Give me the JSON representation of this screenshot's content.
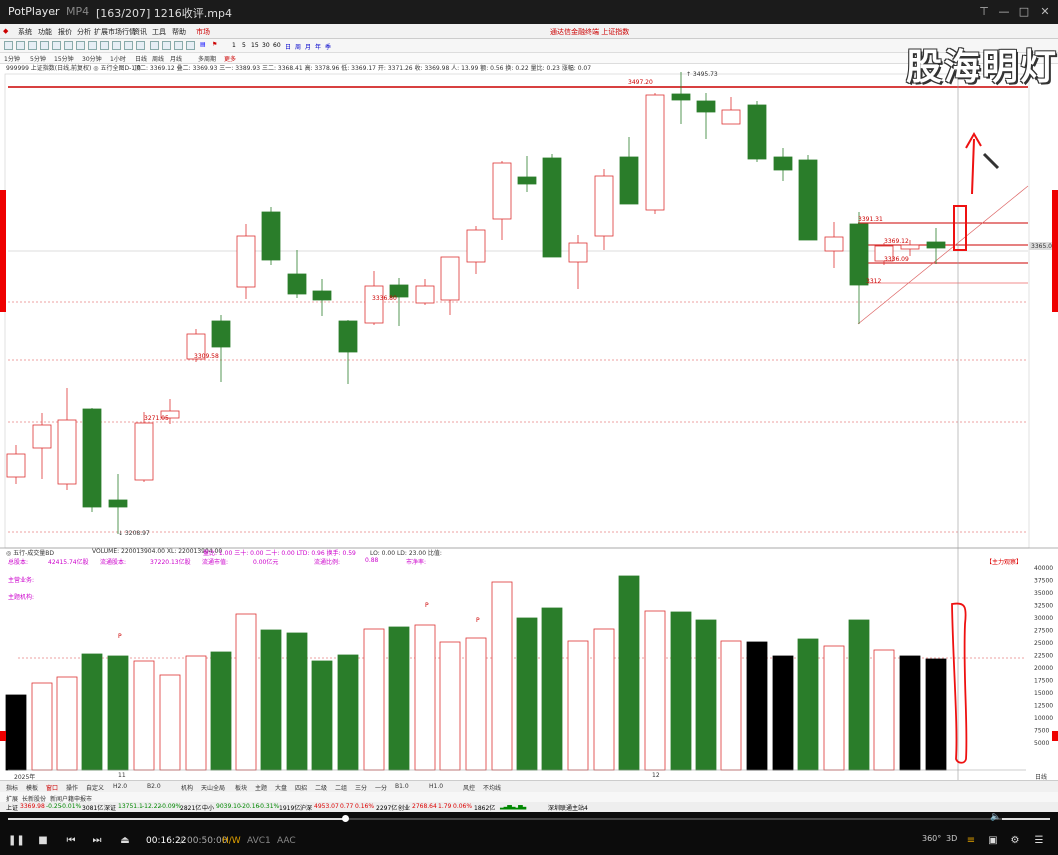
{
  "player": {
    "app_name": "PotPlayer",
    "format": "MP4",
    "file_title": "[163/207] 1216收评.mp4",
    "time_current": "00:16:22",
    "time_total": "00:50:00",
    "hw": "H/W",
    "video_codec": "AVC1",
    "audio_codec": "AAC",
    "progress": 0.327,
    "btn_360": "360°",
    "btn_3d": "3D",
    "watermark": "股海明灯"
  },
  "menu": {
    "items": [
      "系统",
      "功能",
      "报价",
      "分析",
      "扩展市场行情",
      "资讯",
      "工具",
      "帮助"
    ],
    "active": "市场",
    "center_notice": "通达信金融终端 上证指数"
  },
  "periods": [
    "1分钟",
    "5分钟",
    "15分钟",
    "30分钟",
    "1小时",
    "日线",
    "周线",
    "月线",
    "多周期",
    "更多"
  ],
  "toolbar_nums": [
    "1",
    "5",
    "15",
    "30",
    "60",
    "日",
    "周",
    "月",
    "年",
    "季"
  ],
  "chart": {
    "info_line": "999999 上证指数(日线,前复权) ◎ 五行全图D-1.0",
    "info_values": "顶二: 3369.12  叠二: 3369.93  三一: 3389.93  三二: 3368.41  高: 3378.96  低: 3369.17  开: 3371.26  收: 3369.98  人: 13.99  额: 0.56  换: 0.22  量比: 0.23  涨幅: 0.07",
    "price_labels": {
      "hi1": "3497.20",
      "hi2": "3495.73",
      "l3391": "3391.31",
      "l3369": "3369.12",
      "l3336b": "3336.09",
      "l3336": "3336.80",
      "l3309": "3309.58",
      "l3271": "3271.05",
      "lo": "3208.97",
      "right": "3365.0",
      "small": "3312"
    }
  },
  "volume": {
    "title": "◎ 五行-成交量BD",
    "vol_line": "VOLUME: 220013904.00  XL: 220013904.00",
    "ratio_line": "量比: 1.00   三十: 0.00   二十: 0.00   LTD: 0.96   换手: 0.59",
    "lo_line": "LO: 0.00  LD: 23.00  比值:",
    "total_label": "总股本:",
    "total_val": "42415.74亿股",
    "float_label": "流通股本:",
    "float_val": "37220.13亿股",
    "mktcap_label": "流通市值:",
    "mktcap_val": "0.00亿元",
    "ratio_label": "流通比例:",
    "ratio_val": "0.88",
    "pe_label": "市净率:",
    "main_label": "主力流入:",
    "main_label2": "主营业务:",
    "main_label3": "主题机构:",
    "top_right": "【主力观察】",
    "scale": [
      "40000",
      "37500",
      "35000",
      "32500",
      "30000",
      "27500",
      "25000",
      "22500",
      "20000",
      "17500",
      "15000",
      "12500",
      "10000",
      "7500",
      "5000"
    ],
    "year": "2025年",
    "month_a": "11",
    "month_b": "12",
    "corner": "日线"
  },
  "tabs": [
    "指标",
    "模板",
    "窗口",
    "操作",
    "自定义",
    "H2.0",
    "B2.0",
    "机构",
    "天山全局",
    "板块",
    "主题",
    "大盘",
    "四招",
    "二级",
    "二组",
    "三分",
    "一分",
    "B1.0",
    "H1.0",
    "风控",
    "不均线"
  ],
  "index_tabs": [
    "扩展",
    "长新股份",
    "新闻户籍申报市"
  ],
  "status": {
    "sh_label": "上证",
    "sh_val": "3369.98",
    "sh_chg": "-0.25",
    "sh_pct": "-0.01%",
    "sh_amt": "3081亿",
    "sz_label": "深证",
    "sz_val": "13751.1",
    "sz_chg": "-12.22",
    "sz_pct": "-0.09%",
    "sz_amt": "2821亿",
    "zx_label": "中小",
    "zx_val": "9039.10",
    "zx_chg": "-20.16",
    "zx_pct": "-0.31%",
    "zx_amt": "1919亿",
    "hs_label": "沪深",
    "hs_val": "4953.07",
    "hs_chg": "0.77",
    "hs_pct": "0.16%",
    "hs_amt": "2297亿",
    "cy_label": "创业",
    "cy_val": "2768.64",
    "cy_chg": "1.79",
    "cy_pct": "0.06%",
    "cy_amt": "1862亿",
    "server": "深圳联通主站4"
  }
}
